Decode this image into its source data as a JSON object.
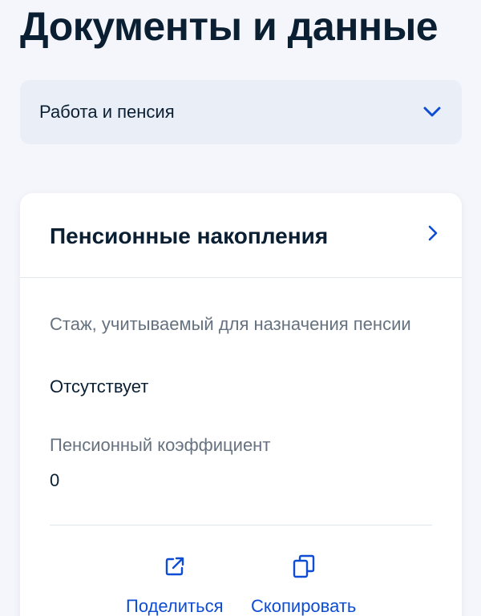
{
  "page": {
    "title": "Документы и данные"
  },
  "category_select": {
    "value": "Работа и пенсия",
    "icon": "chevron-down-icon"
  },
  "card": {
    "title": "Пенсионные накопления",
    "arrow_icon": "chevron-right-icon",
    "fields": [
      {
        "label": "Стаж, учитываемый для назначения пенсии",
        "value": "Отсутствует"
      },
      {
        "label": "Пенсионный коэффициент",
        "value": "0"
      }
    ],
    "actions": [
      {
        "label": "Поделиться",
        "icon": "share-icon"
      },
      {
        "label": "Скопировать",
        "icon": "copy-icon"
      }
    ]
  },
  "colors": {
    "accent": "#0d4cd3",
    "text": "#0b1f33",
    "secondary_text": "#66727f",
    "select_bg": "#e9eef7",
    "page_bg": "#f4f6fb"
  }
}
